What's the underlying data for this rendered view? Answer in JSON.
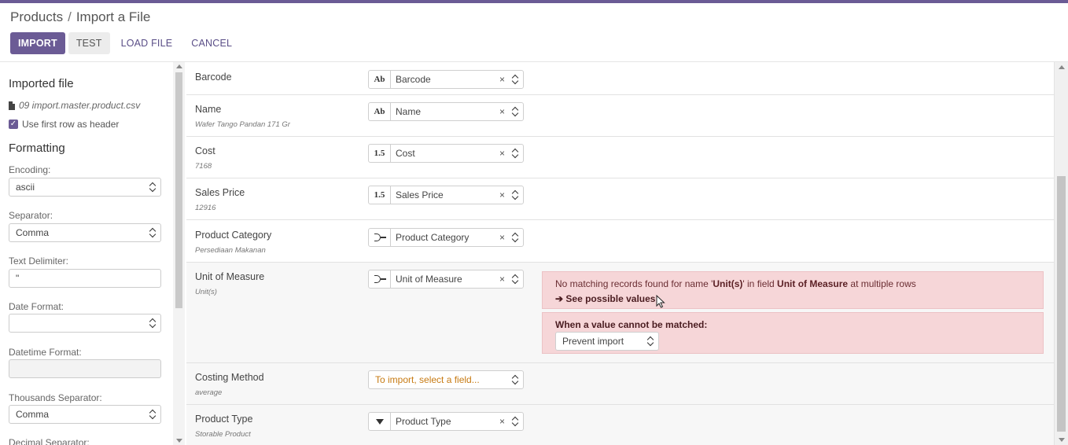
{
  "breadcrumb": {
    "parent": "Products",
    "separator": "/",
    "current": "Import a File"
  },
  "toolbar": {
    "import": "IMPORT",
    "test": "TEST",
    "load_file": "LOAD FILE",
    "cancel": "CANCEL"
  },
  "sidebar": {
    "imported_file_heading": "Imported file",
    "filename": "09 import.master.product.csv",
    "use_first_row": "Use first row as header",
    "use_first_row_checked": true,
    "formatting_heading": "Formatting",
    "encoding_label": "Encoding:",
    "encoding_value": "ascii",
    "separator_label": "Separator:",
    "separator_value": "Comma",
    "text_delimiter_label": "Text Delimiter:",
    "text_delimiter_value": "\"",
    "date_format_label": "Date Format:",
    "date_format_value": "",
    "datetime_format_label": "Datetime Format:",
    "datetime_format_value": "",
    "thousands_separator_label": "Thousands Separator:",
    "thousands_separator_value": "Comma",
    "decimal_separator_label": "Decimal Separator:"
  },
  "rows": [
    {
      "name": "Barcode",
      "sample": "",
      "type_icon": "Ab",
      "field": "Barcode"
    },
    {
      "name": "Name",
      "sample": "Wafer Tango Pandan 171 Gr",
      "type_icon": "Ab",
      "field": "Name"
    },
    {
      "name": "Cost",
      "sample": "7168",
      "type_icon": "1.5",
      "field": "Cost"
    },
    {
      "name": "Sales Price",
      "sample": "12916",
      "type_icon": "1.5",
      "field": "Sales Price"
    },
    {
      "name": "Product Category",
      "sample": "Persediaan Makanan",
      "type_icon": "relation-icon",
      "field": "Product Category"
    },
    {
      "name": "Unit of Measure",
      "sample": "Unit(s)",
      "type_icon": "relation-icon",
      "field": "Unit of Measure"
    },
    {
      "name": "Costing Method",
      "sample": "average",
      "type_icon": "",
      "field": "To import, select a field..."
    },
    {
      "name": "Product Type",
      "sample": "Storable Product",
      "type_icon": "dropdown-icon",
      "field": "Product Type"
    }
  ],
  "clear_glyph": "×",
  "alert": {
    "msg_prefix": "No matching records found for name '",
    "msg_value": "Unit(s)",
    "msg_middle": "' in field ",
    "msg_field": "Unit of Measure",
    "msg_suffix": " at multiple rows",
    "link": "See possible values",
    "link_arrow": "➔",
    "unmatched_label": "When a value cannot be matched:",
    "unmatched_option": "Prevent import"
  },
  "colors": {
    "brand": "#6b5b95",
    "alert_bg": "#f6d6d8",
    "warn_text": "#c77a12"
  }
}
